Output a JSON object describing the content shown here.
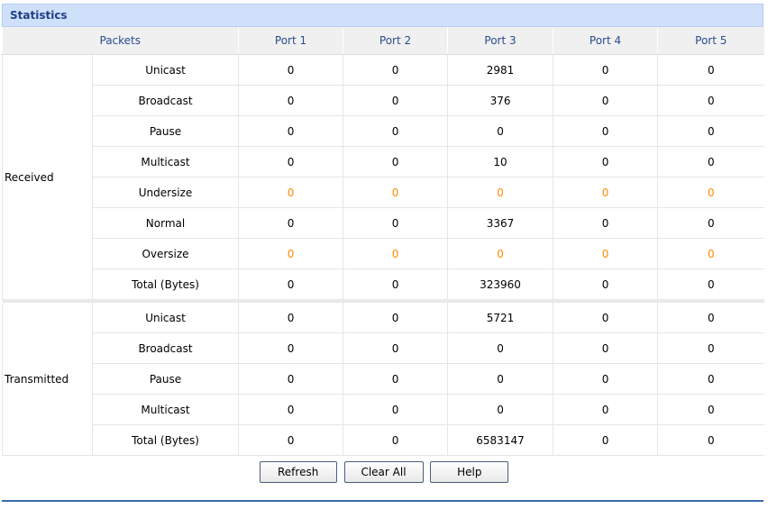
{
  "panel": {
    "title": "Statistics"
  },
  "table": {
    "headers": [
      "Packets",
      "Port 1",
      "Port 2",
      "Port 3",
      "Port 4",
      "Port 5"
    ],
    "groups": [
      {
        "label": "Received",
        "rows": [
          {
            "type": "Unicast",
            "values": [
              "0",
              "0",
              "2981",
              "0",
              "0"
            ],
            "highlight": false
          },
          {
            "type": "Broadcast",
            "values": [
              "0",
              "0",
              "376",
              "0",
              "0"
            ],
            "highlight": false
          },
          {
            "type": "Pause",
            "values": [
              "0",
              "0",
              "0",
              "0",
              "0"
            ],
            "highlight": false
          },
          {
            "type": "Multicast",
            "values": [
              "0",
              "0",
              "10",
              "0",
              "0"
            ],
            "highlight": false
          },
          {
            "type": "Undersize",
            "values": [
              "0",
              "0",
              "0",
              "0",
              "0"
            ],
            "highlight": true
          },
          {
            "type": "Normal",
            "values": [
              "0",
              "0",
              "3367",
              "0",
              "0"
            ],
            "highlight": false
          },
          {
            "type": "Oversize",
            "values": [
              "0",
              "0",
              "0",
              "0",
              "0"
            ],
            "highlight": true
          },
          {
            "type": "Total (Bytes)",
            "values": [
              "0",
              "0",
              "323960",
              "0",
              "0"
            ],
            "highlight": false
          }
        ]
      },
      {
        "label": "Transmitted",
        "rows": [
          {
            "type": "Unicast",
            "values": [
              "0",
              "0",
              "5721",
              "0",
              "0"
            ],
            "highlight": false
          },
          {
            "type": "Broadcast",
            "values": [
              "0",
              "0",
              "0",
              "0",
              "0"
            ],
            "highlight": false
          },
          {
            "type": "Pause",
            "values": [
              "0",
              "0",
              "0",
              "0",
              "0"
            ],
            "highlight": false
          },
          {
            "type": "Multicast",
            "values": [
              "0",
              "0",
              "0",
              "0",
              "0"
            ],
            "highlight": false
          },
          {
            "type": "Total (Bytes)",
            "values": [
              "0",
              "0",
              "6583147",
              "0",
              "0"
            ],
            "highlight": false
          }
        ]
      }
    ],
    "highlight_color": "#ff8a00"
  },
  "buttons": {
    "refresh": "Refresh",
    "clear_all": "Clear All",
    "help": "Help"
  }
}
